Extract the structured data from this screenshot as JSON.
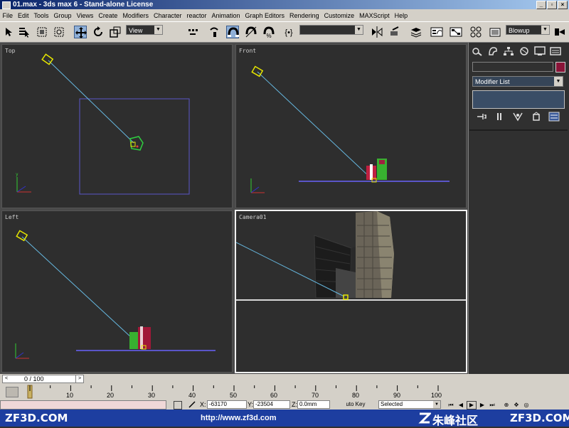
{
  "window": {
    "title": "01.max - 3ds max 6 - Stand-alone License",
    "buttons": [
      "_",
      "▫",
      "×"
    ]
  },
  "menu": [
    "File",
    "Edit",
    "Tools",
    "Group",
    "Views",
    "Create",
    "Modifiers",
    "Character",
    "reactor",
    "Animation",
    "Graph Editors",
    "Rendering",
    "Customize",
    "MAXScript",
    "Help"
  ],
  "toolbar": {
    "coord_system": "View",
    "named_selection": "",
    "render_type": "Blowup"
  },
  "viewports": {
    "top": "Top",
    "front": "Front",
    "left": "Left",
    "camera": "Camera01"
  },
  "command_panel": {
    "object_name": "",
    "object_color": "#8a1438",
    "modifier_list": "Modifier List"
  },
  "time": {
    "slider_text": "0 / 100",
    "ticks": [
      "10",
      "20",
      "30",
      "40",
      "50",
      "60",
      "70",
      "80",
      "90",
      "100"
    ]
  },
  "status": {
    "x_label": "X:",
    "x_value": "-63170",
    "y_label": "Y:",
    "y_value": "-23504",
    "z_label": "Z:",
    "z_value": "0.0mm",
    "auto_key": "Auto Key",
    "selected": "Selected"
  },
  "banner": {
    "left": "ZF3D.COM",
    "url": "http://www.zf3d.com",
    "name": "朱峰社区",
    "right": "ZF3D.COM"
  }
}
